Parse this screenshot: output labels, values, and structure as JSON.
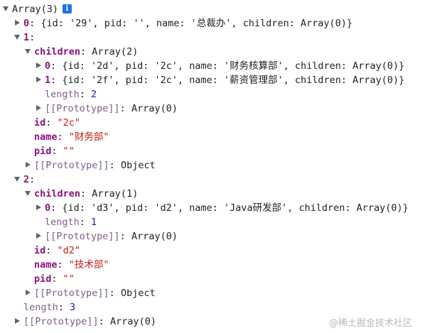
{
  "lines": [
    {
      "prefix": "Array(3)"
    },
    {
      "key": "0",
      "preview": "{id: '29', pid: '', name: '总裁办', children: Array(0)}"
    },
    {
      "key": "1",
      "sep": ":"
    },
    {
      "key": "children",
      "sep": ": ",
      "value": "Array(2)"
    },
    {
      "key": "0",
      "preview": "{id: '2d', pid: '2c', name: '财务核算部', children: Array(0)}"
    },
    {
      "key": "1",
      "preview": "{id: '2f', pid: '2c', name: '薪资管理部', children: Array(0)}"
    },
    {
      "key": "length",
      "sep": ": ",
      "value": "2"
    },
    {
      "key": "[[Prototype]]",
      "sep": ": ",
      "value": "Array(0)"
    },
    {
      "key": "id",
      "sep": ": ",
      "value": "\"2c\""
    },
    {
      "key": "name",
      "sep": ": ",
      "value": "\"财务部\""
    },
    {
      "key": "pid",
      "sep": ": ",
      "value": "\"\""
    },
    {
      "key": "[[Prototype]]",
      "sep": ": ",
      "value": "Object"
    },
    {
      "key": "2",
      "sep": ":"
    },
    {
      "key": "children",
      "sep": ": ",
      "value": "Array(1)"
    },
    {
      "key": "0",
      "preview": "{id: 'd3', pid: 'd2', name: 'Java研发部', children: Array(0)}"
    },
    {
      "key": "length",
      "sep": ": ",
      "value": "1"
    },
    {
      "key": "[[Prototype]]",
      "sep": ": ",
      "value": "Array(0)"
    },
    {
      "key": "id",
      "sep": ": ",
      "value": "\"d2\""
    },
    {
      "key": "name",
      "sep": ": ",
      "value": "\"技术部\""
    },
    {
      "key": "pid",
      "sep": ": ",
      "value": "\"\""
    },
    {
      "key": "[[Prototype]]",
      "sep": ": ",
      "value": "Object"
    },
    {
      "key": "length",
      "sep": ": ",
      "value": "3"
    },
    {
      "key": "[[Prototype]]",
      "sep": ": ",
      "value": "Array(0)"
    }
  ],
  "info_icon": {
    "glyph": "i",
    "icon": "info-icon",
    "color": "#1a73e8"
  },
  "watermark": "@稀土掘金技术社区"
}
